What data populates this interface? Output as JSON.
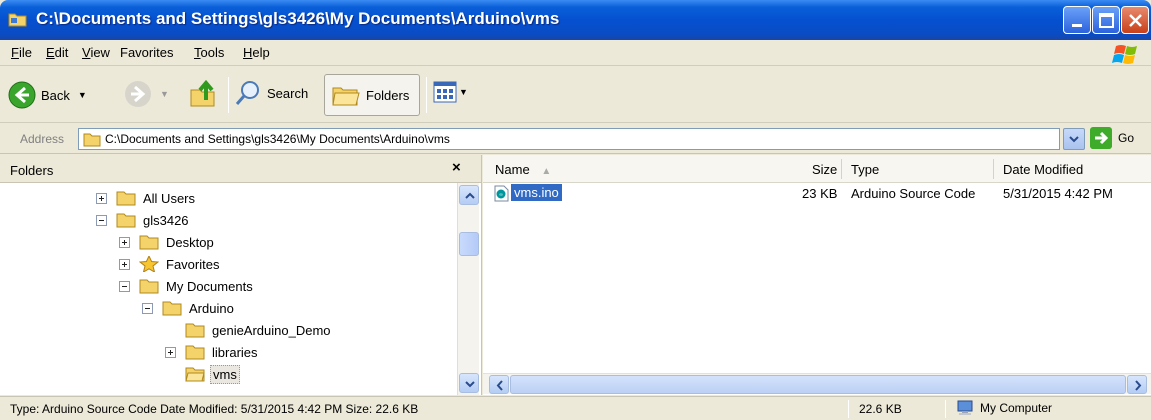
{
  "window": {
    "title": "C:\\Documents and Settings\\gls3426\\My Documents\\Arduino\\vms"
  },
  "menu": {
    "items": [
      {
        "ul": "F",
        "rest": "ile"
      },
      {
        "ul": "E",
        "rest": "dit"
      },
      {
        "ul": "V",
        "rest": "iew"
      },
      {
        "ul": "",
        "rest": "Favorites",
        "ulpos": 1
      },
      {
        "ul": "T",
        "rest": "ools"
      },
      {
        "ul": "H",
        "rest": "elp"
      }
    ]
  },
  "toolbar": {
    "back_label": "Back",
    "search_label": "Search",
    "folders_label": "Folders"
  },
  "address": {
    "label": "Address",
    "value": "C:\\Documents and Settings\\gls3426\\My Documents\\Arduino\\vms",
    "go_label": "Go"
  },
  "folders_pane": {
    "title": "Folders",
    "close": "×",
    "tree": [
      {
        "label": "All Users",
        "expander": "plus",
        "icon": "folder",
        "indent": 0
      },
      {
        "label": "gls3426",
        "expander": "minus",
        "icon": "folder",
        "indent": 0
      },
      {
        "label": "Desktop",
        "expander": "plus",
        "icon": "folder",
        "indent": 1
      },
      {
        "label": "Favorites",
        "expander": "plus",
        "icon": "star",
        "indent": 1
      },
      {
        "label": "My Documents",
        "expander": "minus",
        "icon": "folder",
        "indent": 1
      },
      {
        "label": "Arduino",
        "expander": "minus",
        "icon": "folder",
        "indent": 2
      },
      {
        "label": "genieArduino_Demo",
        "expander": "none",
        "icon": "folder",
        "indent": 3
      },
      {
        "label": "libraries",
        "expander": "plus",
        "icon": "folder",
        "indent": 3
      },
      {
        "label": "vms",
        "expander": "none",
        "icon": "folder",
        "indent": 3,
        "selected": true
      }
    ]
  },
  "files_pane": {
    "columns": {
      "name": "Name",
      "size": "Size",
      "type": "Type",
      "date": "Date Modified"
    },
    "sort_indicator": "▲",
    "files": [
      {
        "name": "vms.ino",
        "size": "23 KB",
        "type": "Arduino Source Code",
        "date": "5/31/2015 4:42 PM"
      }
    ]
  },
  "status": {
    "text": "Type: Arduino Source Code Date Modified: 5/31/2015 4:42 PM Size: 22.6 KB",
    "size": "22.6 KB",
    "zone": "My Computer"
  },
  "colors": {
    "titlebar": "#0a54d4",
    "selection": "#316ac5",
    "chrome": "#ece9d8"
  }
}
